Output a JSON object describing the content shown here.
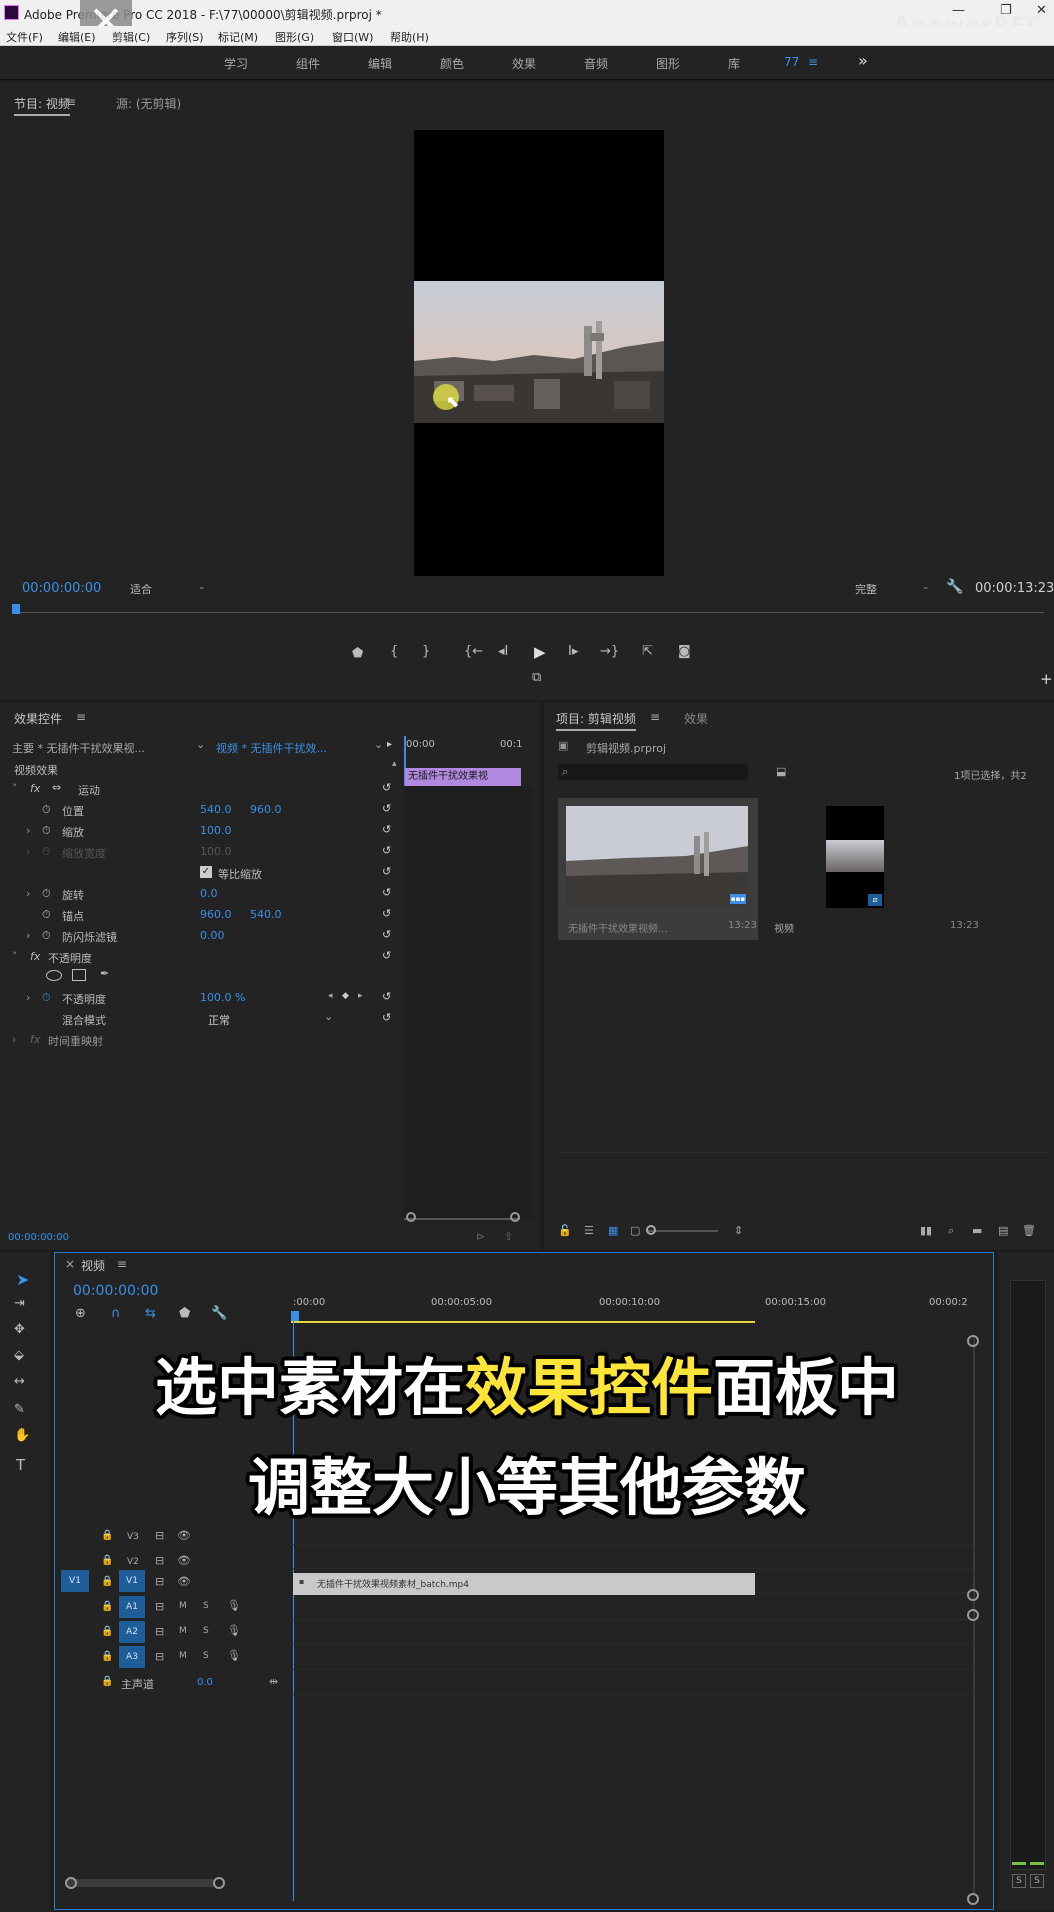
{
  "titlebar": {
    "title": "Adobe Premiere Pro CC 2018 - F:\\77\\00000\\剪辑视频.prproj *",
    "watermark": "ApowerREC",
    "close_overlay": "✕"
  },
  "menu": [
    "文件(F)",
    "编辑(E)",
    "剪辑(C)",
    "序列(S)",
    "标记(M)",
    "图形(G)",
    "窗口(W)",
    "帮助(H)"
  ],
  "workspaces": [
    "学习",
    "组件",
    "编辑",
    "颜色",
    "效果",
    "音频",
    "图形",
    "库",
    "77",
    "≡",
    "»"
  ],
  "program": {
    "tab": "节目: 视频",
    "source_tab": "源: (无剪辑)",
    "timecode": "00:00:00:00",
    "fit": "适合",
    "quality": "完整",
    "duration": "00:00:13:23"
  },
  "effects": {
    "tab": "效果控件",
    "master": "主要 * 无插件干扰效果视...",
    "clip": "视频 * 无插件干扰效...",
    "ruler_start": "00:00",
    "ruler_end": "00:1",
    "clip_label": "无插件干扰效果视",
    "section": "视频效果",
    "motion": "运动",
    "position": "位置",
    "pos_x": "540.0",
    "pos_y": "960.0",
    "scale": "缩放",
    "scale_v": "100.0",
    "scale_w": "缩放宽度",
    "scale_w_v": "100.0",
    "uniform": "等比缩放",
    "rotation": "旋转",
    "rotation_v": "0.0",
    "anchor": "锚点",
    "anchor_x": "960.0",
    "anchor_y": "540.0",
    "flicker": "防闪烁滤镜",
    "flicker_v": "0.00",
    "opacity_section": "不透明度",
    "opacity": "不透明度",
    "opacity_v": "100.0 %",
    "blend": "混合模式",
    "blend_v": "正常",
    "remap": "时间重映射",
    "bottom_tc": "00:00:00:00"
  },
  "project": {
    "tab": "项目: 剪辑视频",
    "tab2": "效果",
    "file": "剪辑视频.prproj",
    "selection": "1项已选择，共2",
    "item1_name": "无插件干扰效果视频...",
    "item1_dur": "13:23",
    "item2_name": "视频",
    "item2_dur": "13:23"
  },
  "timeline": {
    "tab": "视频",
    "timecode": "00:00:00:00",
    "ruler": [
      ":00:00",
      "00:00:05:00",
      "00:00:10:00",
      "00:00:15:00",
      "00:00:2"
    ],
    "tracks": [
      {
        "id": "V3"
      },
      {
        "id": "V2"
      },
      {
        "id": "V1"
      },
      {
        "id": "A1"
      },
      {
        "id": "A2"
      },
      {
        "id": "A3"
      }
    ],
    "v1_source": "V1",
    "master": "主声道",
    "master_v": "0.0",
    "clip_name": "无插件干扰效果视频素材_batch.mp4"
  },
  "overlay": {
    "line1a": "选中素材在",
    "line1b": "效果控件",
    "line1c": "面板中",
    "line2": "调整大小等其他参数"
  },
  "meter": {
    "s1": "S",
    "s2": "S"
  }
}
